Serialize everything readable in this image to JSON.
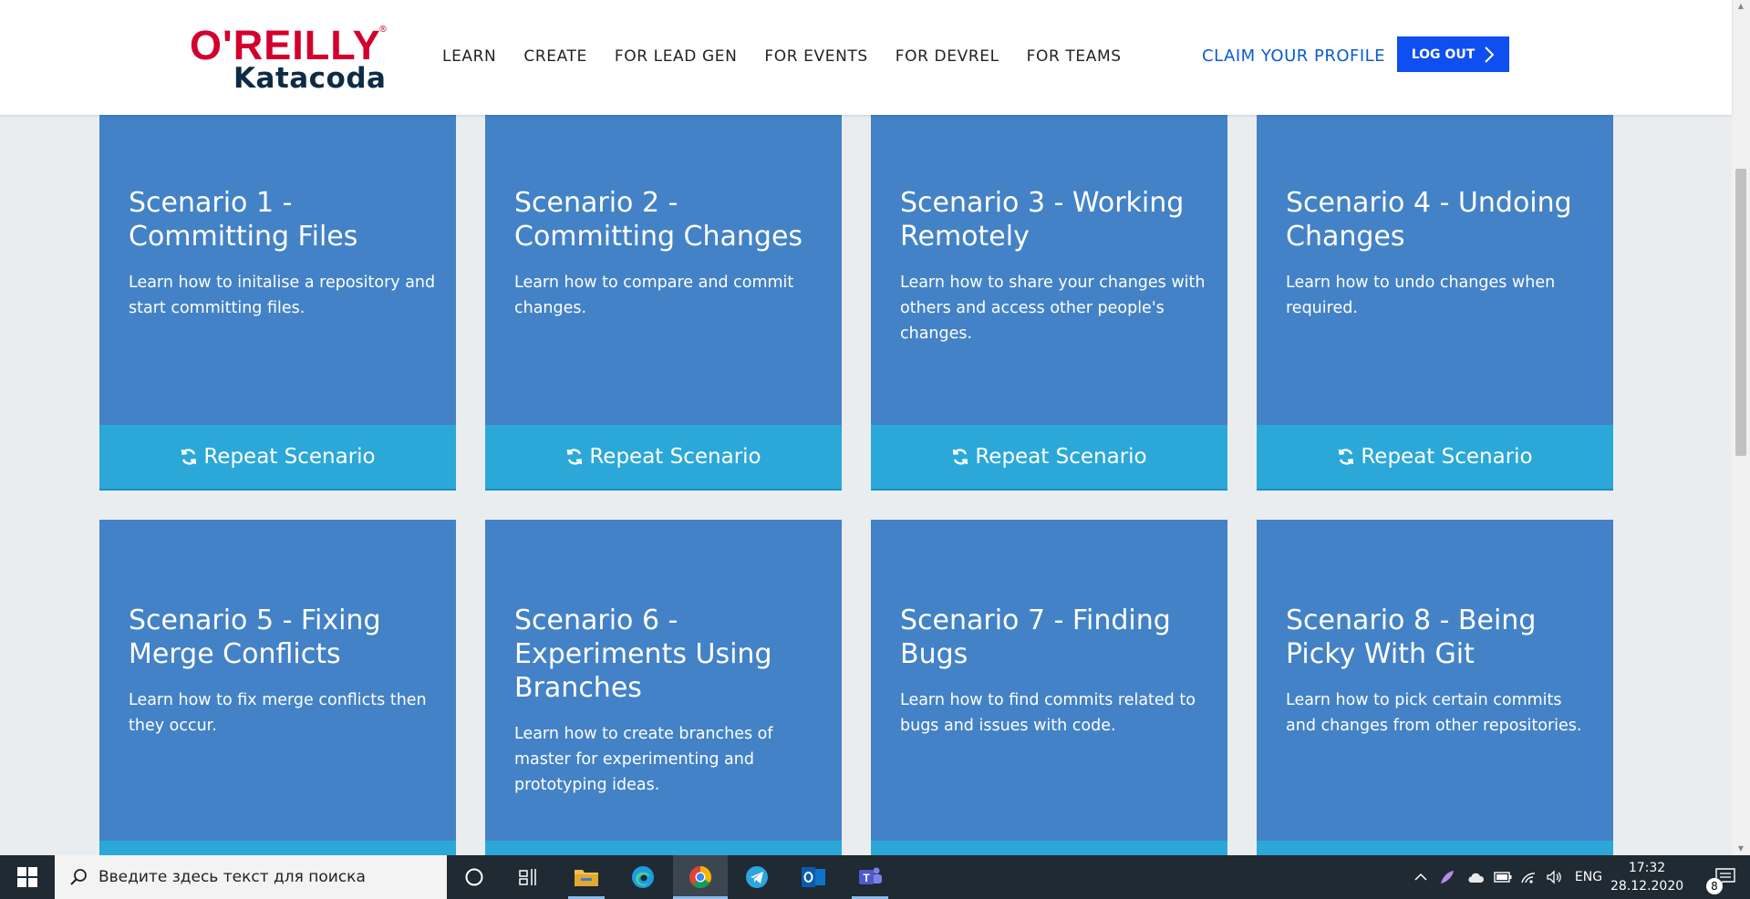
{
  "header": {
    "logo_oreilly": "O'REILLY",
    "logo_reg": "®",
    "logo_katakoda": "Katacoda",
    "nav": [
      "LEARN",
      "CREATE",
      "FOR LEAD GEN",
      "FOR EVENTS",
      "FOR DEVREL",
      "FOR TEAMS"
    ],
    "claim_profile": "CLAIM YOUR PROFILE",
    "logout": "LOG OUT"
  },
  "scenarios": [
    {
      "title": "Scenario 1 - Committing Files",
      "desc": "Learn how to initalise a repository and start committing files.",
      "button": "Repeat Scenario"
    },
    {
      "title": "Scenario 2 - Committing Changes",
      "desc": "Learn how to compare and commit changes.",
      "button": "Repeat Scenario"
    },
    {
      "title": "Scenario 3 - Working Remotely",
      "desc": "Learn how to share your changes with others and access other people's changes.",
      "button": "Repeat Scenario"
    },
    {
      "title": "Scenario 4 - Undoing Changes",
      "desc": "Learn how to undo changes when required.",
      "button": "Repeat Scenario"
    },
    {
      "title": "Scenario 5 - Fixing Merge Conflicts",
      "desc": "Learn how to fix merge conflicts then they occur.",
      "button": ""
    },
    {
      "title": "Scenario 6 - Experiments Using Branches",
      "desc": "Learn how to create branches of master for experimenting and prototyping ideas.",
      "button": ""
    },
    {
      "title": "Scenario 7 - Finding Bugs",
      "desc": "Learn how to find commits related to bugs and issues with code.",
      "button": ""
    },
    {
      "title": "Scenario 8 - Being Picky With Git",
      "desc": "Learn how to pick certain commits and changes from other repositories.",
      "button": ""
    }
  ],
  "taskbar": {
    "search_placeholder": "Введите здесь текст для поиска",
    "language": "ENG",
    "time": "17:32",
    "date": "28.12.2020",
    "notification_count": "8"
  },
  "colors": {
    "card": "#4382c6",
    "card_button": "#2ba8d8",
    "logout": "#0f4ef0",
    "claim": "#0a5bd3",
    "oreilly_red": "#d3002d",
    "page_bg": "#e9edf0",
    "taskbar": "#1f2a33"
  }
}
